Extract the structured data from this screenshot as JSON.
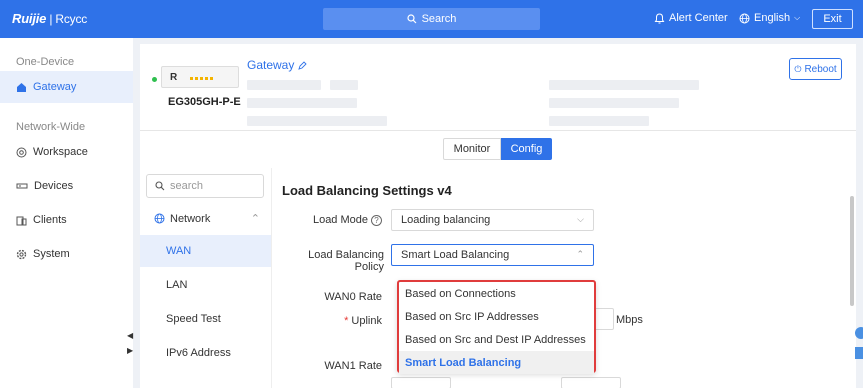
{
  "topbar": {
    "logo_brand": "Ruijie",
    "logo_product": "Rcycc",
    "search_label": "Search",
    "alert_label": "Alert Center",
    "language_label": "English",
    "exit_label": "Exit"
  },
  "sidebar": {
    "section_one_device": "One-Device",
    "section_network_wide": "Network-Wide",
    "items": [
      {
        "label": "Gateway",
        "icon": "home-icon"
      },
      {
        "label": "Workspace",
        "icon": "workspace-icon"
      },
      {
        "label": "Devices",
        "icon": "devices-icon"
      },
      {
        "label": "Clients",
        "icon": "clients-icon"
      },
      {
        "label": "System",
        "icon": "gear-icon"
      }
    ]
  },
  "device": {
    "model": "EG305GH-P-E",
    "name": "Gateway",
    "reboot_label": "Reboot",
    "status_color": "#2fbf4f"
  },
  "tabs": {
    "monitor": "Monitor",
    "config": "Config"
  },
  "inner_nav": {
    "search_placeholder": "search",
    "group_label": "Network",
    "items": [
      "WAN",
      "LAN",
      "Speed Test",
      "IPv6 Address"
    ]
  },
  "form": {
    "title": "Load Balancing Settings v4",
    "load_mode_label": "Load Mode",
    "load_mode_value": "Loading balancing",
    "policy_label": "Load Balancing Policy",
    "policy_value": "Smart Load Balancing",
    "wan0_rate_label": "WAN0 Rate",
    "uplink_label": "Uplink",
    "mbps_unit": "Mbps",
    "wan1_rate_label": "WAN1 Rate"
  },
  "dropdown": {
    "options": [
      "Based on Connections",
      "Based on Src IP Addresses",
      "Based on Src and Dest IP Addresses",
      "Smart Load Balancing"
    ],
    "selected_index": 3
  },
  "colors": {
    "brand": "#2f72e8",
    "highlight_border": "#e03c3c"
  }
}
